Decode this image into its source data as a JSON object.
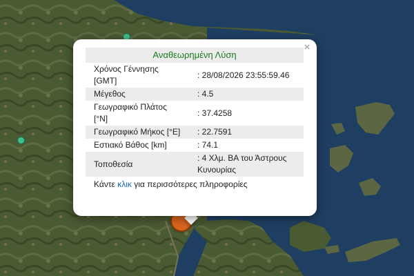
{
  "popup": {
    "header": "Αναθεωρημένη Λύση",
    "rows": [
      {
        "label": "Χρόνος Γέννησης [GMT]",
        "value": ": 28/08/2026 23:55:59.46"
      },
      {
        "label": "Μέγεθος",
        "value": ": 4.5"
      },
      {
        "label": "Γεωγραφικό Πλάτος [°N]",
        "value": ": 37.4258"
      },
      {
        "label": "Γεωγραφικό Μήκος [°E]",
        "value": ": 22.7591"
      },
      {
        "label": "Εστιακό Βάθος [km]",
        "value": ": 74.1"
      },
      {
        "label": "Τοποθεσία",
        "value": ": 4 Χλμ. ΒΑ του Άστρους Κυνουρίας"
      }
    ],
    "more_prefix": "Κάντε",
    "more_link": "κλικ",
    "more_suffix": "για περισσότερες πληροφορίες",
    "close_symbol": "×"
  },
  "map": {
    "land_color": "#4a5a33",
    "sea_color": "#1f3f62",
    "quake_marker_color": "#d8651e",
    "station_marker_color": "#3fbf8a"
  }
}
